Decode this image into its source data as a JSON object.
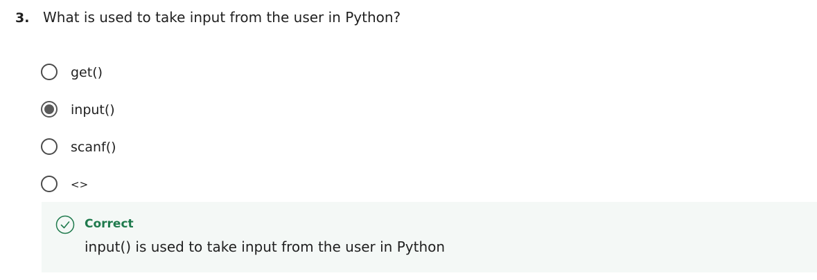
{
  "question": {
    "number": "3.",
    "text": "What is used to take input from the user in Python?"
  },
  "options": [
    {
      "label": "get()",
      "selected": false
    },
    {
      "label": "input()",
      "selected": true
    },
    {
      "label": "scanf()",
      "selected": false
    },
    {
      "label": "<>",
      "selected": false
    }
  ],
  "feedback": {
    "status": "Correct",
    "explanation": "input() is used to take input from the user in Python",
    "icon": "check-circle-icon",
    "status_color": "#1f7a4d",
    "background_color": "#f4f8f6"
  }
}
